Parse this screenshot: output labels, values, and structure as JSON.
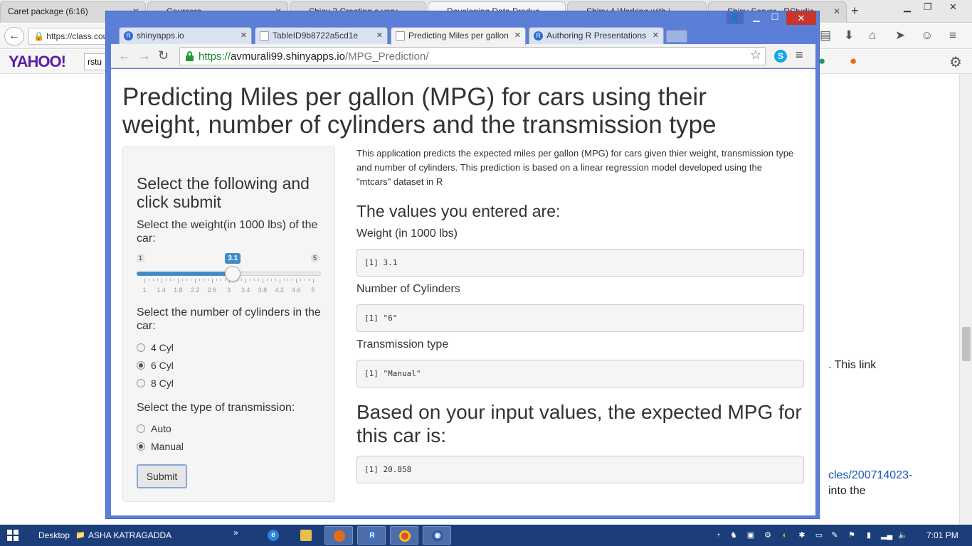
{
  "bg_browser": {
    "tabs": [
      {
        "label": "Caret package (6:16)"
      },
      {
        "label": "Coursera"
      },
      {
        "label": "Shiny 3 Creating a very"
      },
      {
        "label": "Developing Data Produc"
      },
      {
        "label": "Shiny 4 Working with i"
      },
      {
        "label": "Shiny Server - RStudio"
      }
    ],
    "new_tab": "+",
    "url": "https://class.cou",
    "yahoo": "YAHOO!",
    "yahoo_input": "rstu",
    "content_lines": [
      ". This link",
      "cles/200714023-",
      " into the"
    ]
  },
  "chrome": {
    "tabs": [
      {
        "label": "shinyapps.io",
        "favicon": "R"
      },
      {
        "label": "TableID9b8722a5cd1e",
        "favicon": "doc"
      },
      {
        "label": "Predicting Miles per gallon",
        "favicon": "doc"
      },
      {
        "label": "Authoring R Presentations",
        "favicon": "R"
      }
    ],
    "url": {
      "scheme": "https://",
      "host": "avmurali99.shinyapps.io",
      "path": "/MPG_Prediction/"
    }
  },
  "app": {
    "title": "Predicting Miles per gallon (MPG) for cars using their weight, number of cylinders and the transmission type",
    "sidebar": {
      "heading": "Select the following and click submit",
      "weight_label": "Select the weight(in 1000 lbs) of the car:",
      "slider": {
        "min": 1,
        "max": 5,
        "value": 3.1,
        "min_label": "1",
        "max_label": "5",
        "value_label": "3.1",
        "tick_labels": [
          "1",
          "1.4",
          "1.8",
          "2.2",
          "2.6",
          "3",
          "3.4",
          "3.8",
          "4.2",
          "4.6",
          "5"
        ]
      },
      "cyl_label": "Select the number of cylinders in the car:",
      "cyl_options": [
        {
          "label": "4 Cyl",
          "checked": false
        },
        {
          "label": "6 Cyl",
          "checked": true
        },
        {
          "label": "8 Cyl",
          "checked": false
        }
      ],
      "trans_label": "Select the type of transmission:",
      "trans_options": [
        {
          "label": "Auto",
          "checked": false
        },
        {
          "label": "Manual",
          "checked": true
        }
      ],
      "submit": "Submit"
    },
    "main": {
      "intro": "This application predicts the expected miles per gallon (MPG) for cars given thier weight, transmission type and number of cylinders. This prediction is based on a linear regression model developed using the \"mtcars\" dataset in R",
      "entered_heading": "The values you entered are:",
      "weight_label": "Weight (in 1000 lbs)",
      "weight_value": "[1] 3.1",
      "cyl_label": "Number of Cylinders",
      "cyl_value": "[1] \"6\"",
      "trans_label": "Transmission type",
      "trans_value": "[1] \"Manual\"",
      "mpg_heading": "Based on your input values, the expected MPG for this car is:",
      "mpg_value": "[1] 20.858"
    }
  },
  "taskbar": {
    "desktop": "Desktop",
    "user": "ASHA KATRAGADDA",
    "chevron": "»",
    "clock": "7:01 PM"
  },
  "colors": {
    "chrome_frame": "#5b7fd6",
    "slider_blue": "#428bca",
    "url_green": "#1a8a2a",
    "taskbar": "#1b3d7a"
  }
}
